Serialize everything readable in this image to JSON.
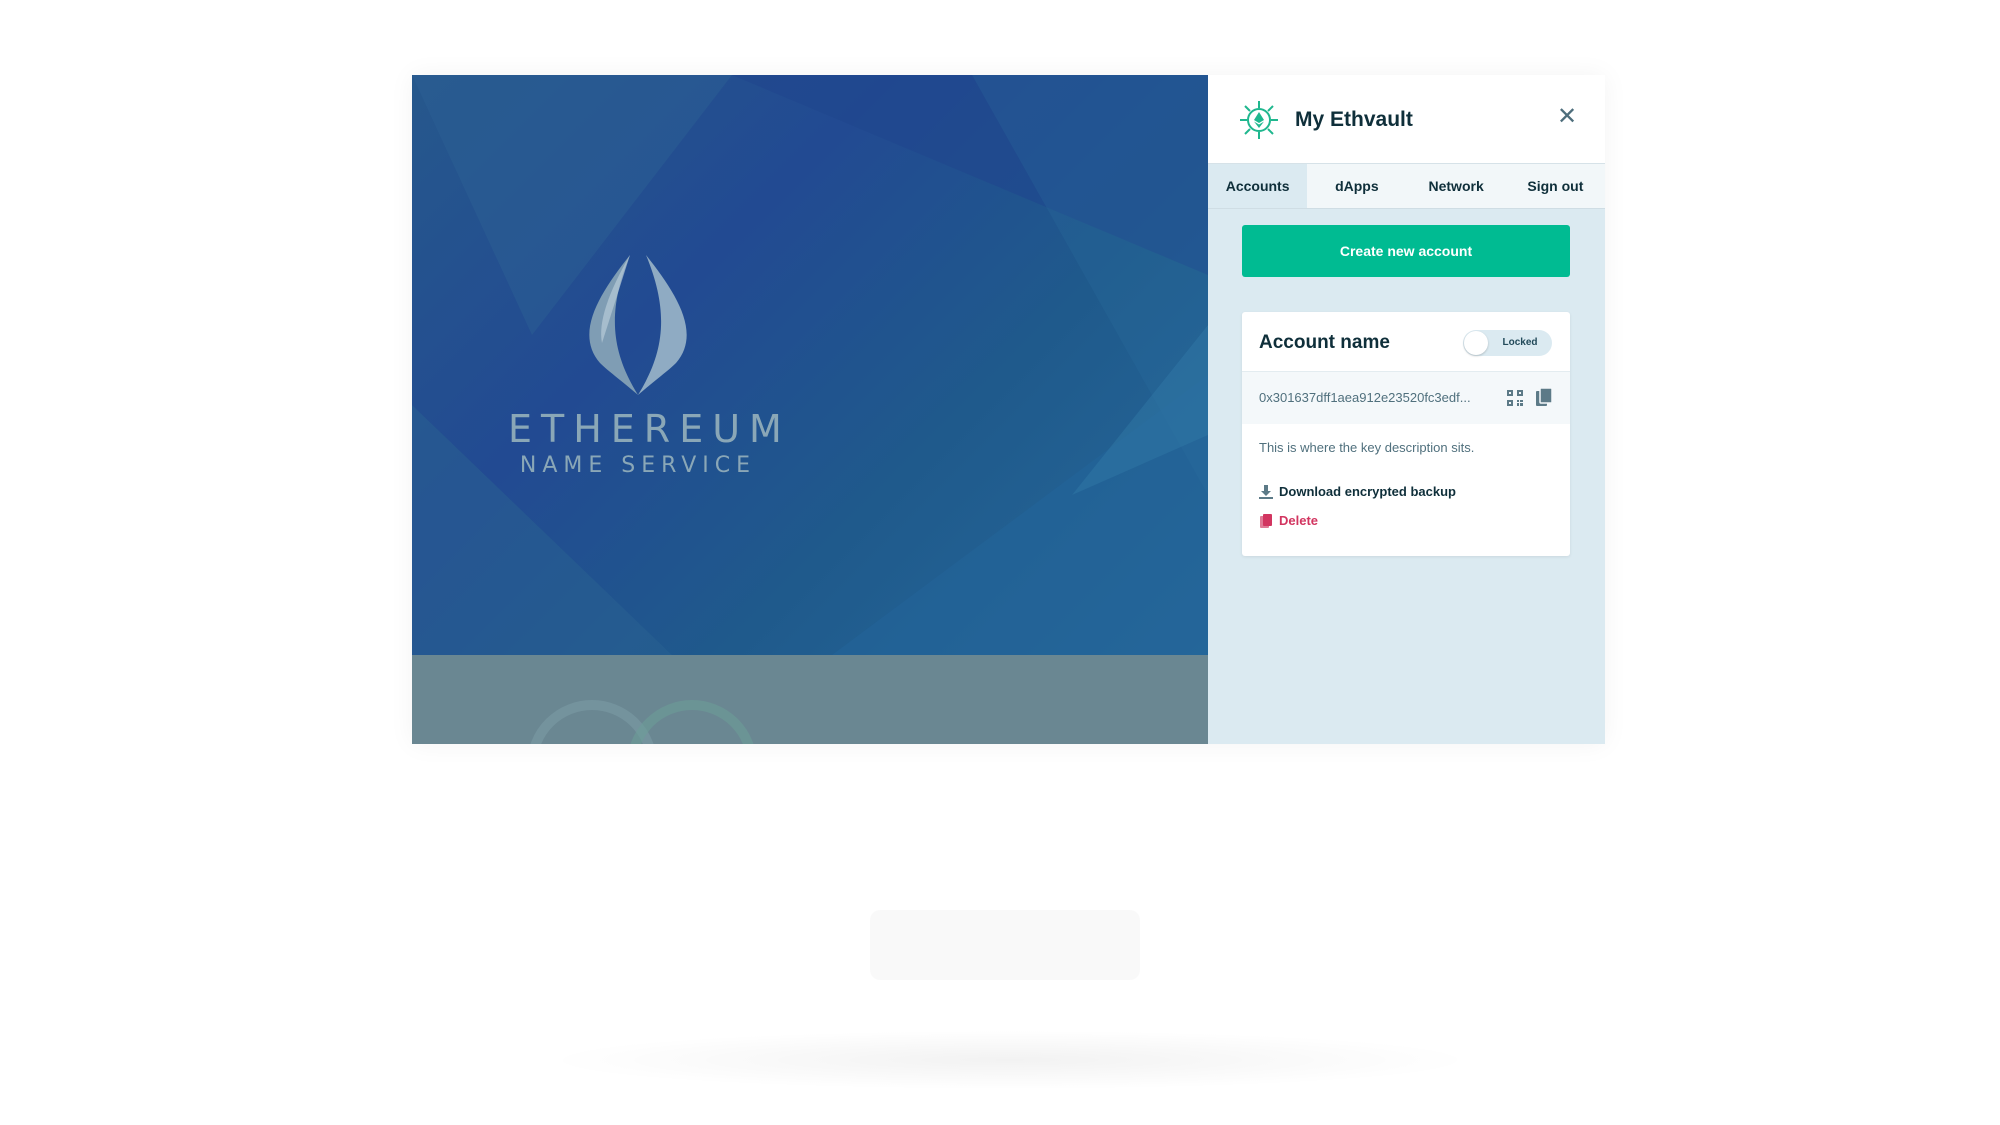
{
  "hero": {
    "logo_title": "ETHEREUM",
    "logo_subtitle": "NAME SERVICE"
  },
  "panel": {
    "brand_title": "My Ethvault",
    "close_icon": "close-icon",
    "tabs": [
      {
        "label": "Accounts",
        "active": true
      },
      {
        "label": "dApps",
        "active": false
      },
      {
        "label": "Network",
        "active": false
      },
      {
        "label": "Sign out",
        "active": false
      }
    ],
    "create_button": "Create new account",
    "account": {
      "name": "Account name",
      "lock_status": "Locked",
      "address": "0x301637dff1aea912e23520fc3edf...",
      "description": "This is where the key description sits.",
      "download_label": "Download encrypted backup",
      "delete_label": "Delete"
    }
  },
  "colors": {
    "accent": "#00bb92",
    "danger": "#d23560",
    "panel_bg": "#dbeaf1",
    "hero_blue": "#224a92"
  }
}
